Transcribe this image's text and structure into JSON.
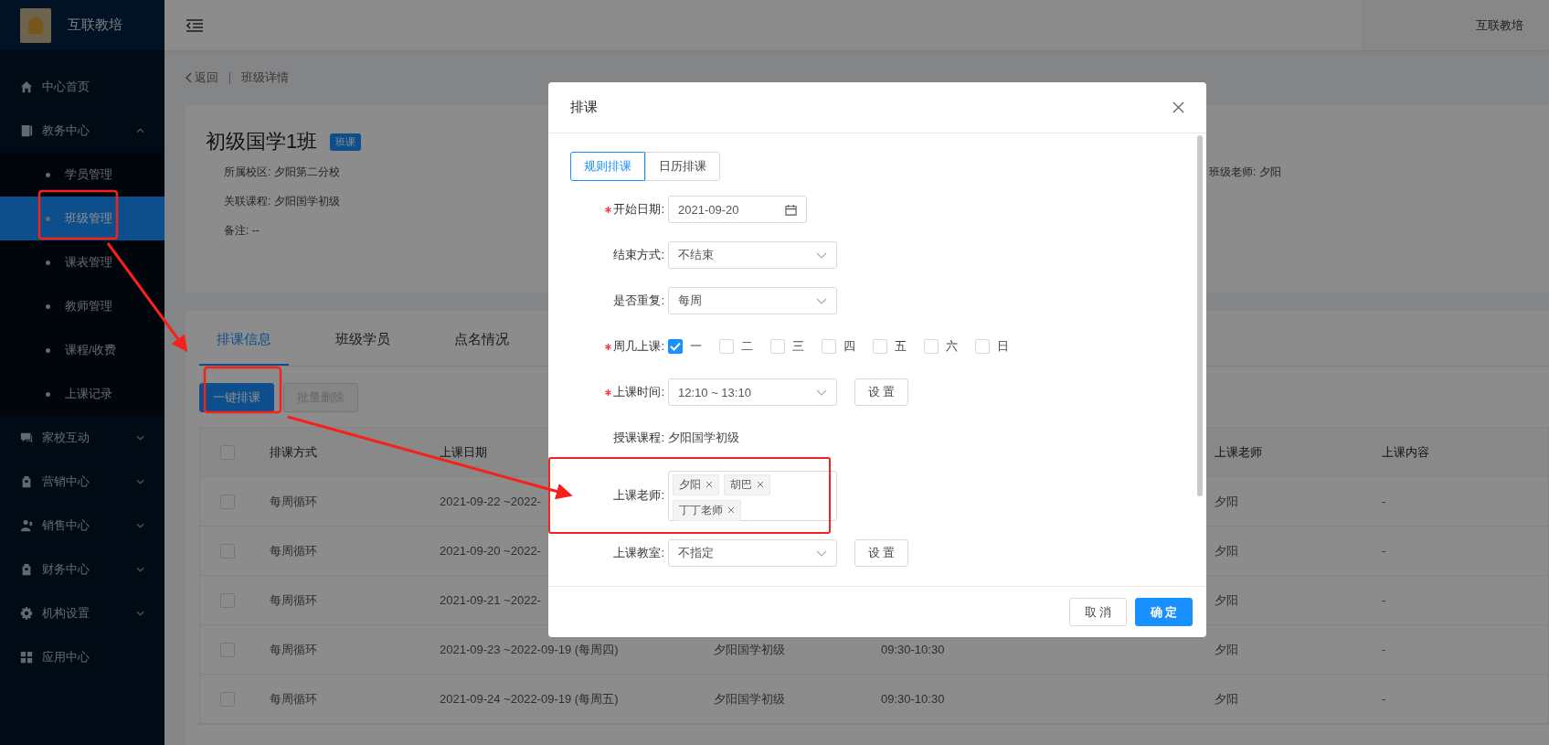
{
  "app": {
    "name": "互联教培"
  },
  "header": {
    "user": "互联教培"
  },
  "sidebar": {
    "items": [
      {
        "kind": "link",
        "label": "中心首页"
      },
      {
        "kind": "group",
        "label": "教务中心",
        "expanded": true,
        "children": [
          {
            "label": "学员管理",
            "selected": false
          },
          {
            "label": "班级管理",
            "selected": true
          },
          {
            "label": "课表管理",
            "selected": false
          },
          {
            "label": "教师管理",
            "selected": false
          },
          {
            "label": "课程/收费",
            "selected": false
          },
          {
            "label": "上课记录",
            "selected": false
          }
        ]
      },
      {
        "kind": "group",
        "label": "家校互动",
        "expanded": false
      },
      {
        "kind": "group",
        "label": "营销中心",
        "expanded": false
      },
      {
        "kind": "group",
        "label": "销售中心",
        "expanded": false
      },
      {
        "kind": "group",
        "label": "财务中心",
        "expanded": false
      },
      {
        "kind": "group",
        "label": "机构设置",
        "expanded": false
      },
      {
        "kind": "link",
        "label": "应用中心"
      }
    ]
  },
  "breadcrumb": {
    "back": "返回",
    "current": "班级详情"
  },
  "class_info": {
    "title": "初级国学1班",
    "badge": "班课",
    "fields": [
      "所属校区: 夕阳第二分校",
      "关联课程: 夕阳国学初级",
      "备注: --"
    ],
    "teacher": "班级老师:  夕阳"
  },
  "tabs": [
    {
      "label": "排课信息",
      "selected": true
    },
    {
      "label": "班级学员",
      "selected": false
    },
    {
      "label": "点名情况",
      "selected": false
    }
  ],
  "actions": [
    {
      "label": "一键排课",
      "disabled": false
    },
    {
      "label": "批量删除",
      "disabled": true
    }
  ],
  "table": {
    "select_all_checked": false,
    "columns": {
      "mode": "排课方式",
      "date": "上课日期",
      "teacher": "上课老师",
      "content": "上课内容"
    },
    "rows": [
      {
        "checked": false,
        "mode": "每周循环",
        "date": "2021-09-22 ~2022-",
        "teacher": "夕阳",
        "content": "-"
      },
      {
        "checked": false,
        "mode": "每周循环",
        "date": "2021-09-20 ~2022-",
        "teacher": "夕阳",
        "content": "-"
      },
      {
        "checked": false,
        "mode": "每周循环",
        "date": "2021-09-21 ~2022-",
        "teacher": "夕阳",
        "content": "-"
      },
      {
        "checked": false,
        "mode": "每周循环",
        "date": "2021-09-23 ~2022-09-19 (每周四)",
        "course": "夕阳国学初级",
        "time": "09:30-10:30",
        "teacher": "夕阳",
        "content": "-"
      },
      {
        "checked": false,
        "mode": "每周循环",
        "date": "2021-09-24 ~2022-09-19 (每周五)",
        "course": "夕阳国学初级",
        "time": "09:30-10:30",
        "teacher": "夕阳",
        "content": "-"
      }
    ]
  },
  "modal": {
    "title": "排课",
    "tabs": [
      {
        "label": "规则排课",
        "selected": true
      },
      {
        "label": "日历排课",
        "selected": false
      }
    ],
    "fields": [
      {
        "kind": "date",
        "label": "开始日期:",
        "required": true,
        "value": "2021-09-20"
      },
      {
        "kind": "select",
        "label": "结束方式:",
        "required": false,
        "value": "不结束"
      },
      {
        "kind": "select",
        "label": "是否重复:",
        "required": false,
        "value": "每周"
      },
      {
        "kind": "days",
        "label": "周几上课:",
        "required": true,
        "options": [
          {
            "label": "一",
            "checked": true
          },
          {
            "label": "二",
            "checked": false
          },
          {
            "label": "三",
            "checked": false
          },
          {
            "label": "四",
            "checked": false
          },
          {
            "label": "五",
            "checked": false
          },
          {
            "label": "六",
            "checked": false
          },
          {
            "label": "日",
            "checked": false
          }
        ]
      },
      {
        "kind": "select",
        "label": "上课时间:",
        "required": true,
        "value": "12:10 ~ 13:10",
        "button": "设 置"
      },
      {
        "kind": "text",
        "label": "授课课程:",
        "required": false,
        "value": "夕阳国学初级"
      },
      {
        "kind": "tags",
        "label": "上课老师:",
        "required": false,
        "tags": [
          "夕阳",
          "胡巴",
          "丁丁老师"
        ]
      },
      {
        "kind": "select",
        "label": "上课教室:",
        "required": false,
        "value": "不指定",
        "button": "设 置"
      }
    ],
    "buttons": [
      {
        "label": "取 消",
        "primary": false
      },
      {
        "label": "确 定",
        "primary": true
      }
    ]
  }
}
